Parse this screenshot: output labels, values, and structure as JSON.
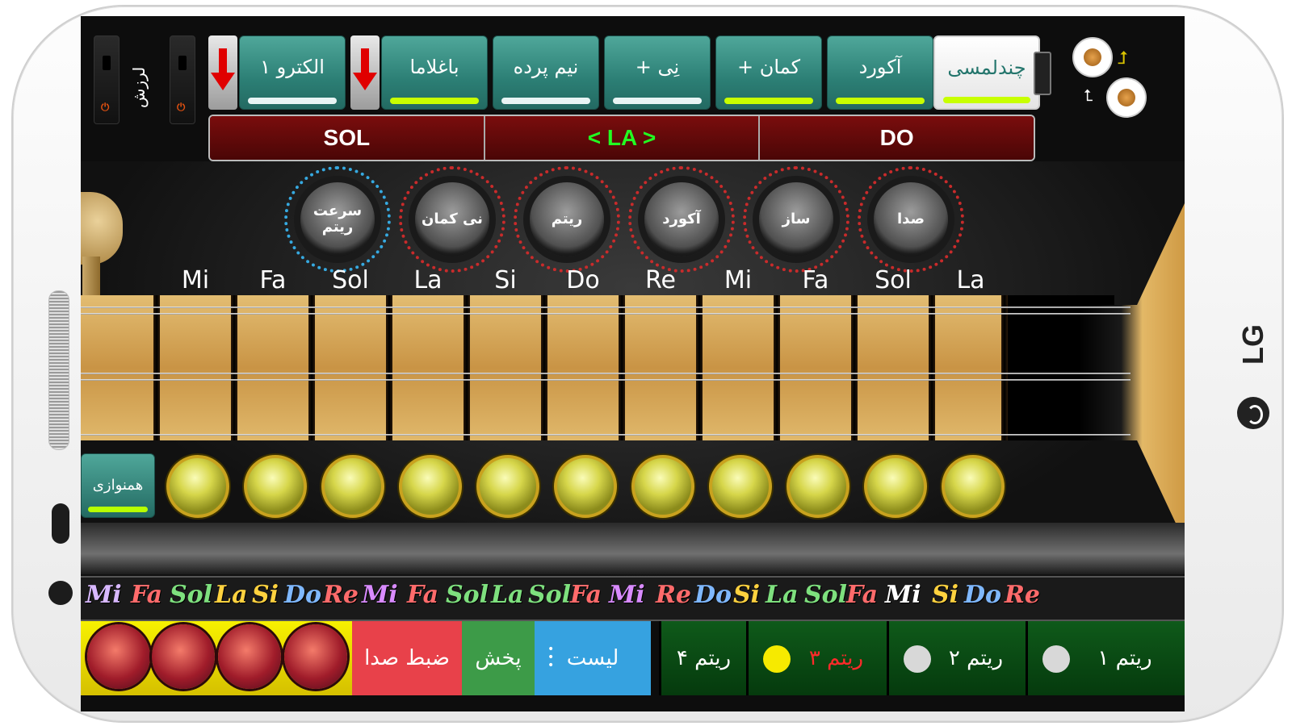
{
  "device": {
    "brand": "LG"
  },
  "top": {
    "vibrato_label": "لرزش",
    "switch_power": "⏻",
    "tabs": [
      {
        "label": "الکترو ۱",
        "bar_color": "#e8f4f4"
      },
      {
        "label": "باغلاما",
        "bar_color": "#c8ff00"
      },
      {
        "label": "نیم پرده",
        "bar_color": "#e8f4f4"
      },
      {
        "label": "+ نِی",
        "bar_color": "#e8f4f4"
      },
      {
        "label": "+ کمان",
        "bar_color": "#c8ff00"
      },
      {
        "label": "آکورد",
        "bar_color": "#c8ff00"
      },
      {
        "label": "چندلمسی",
        "bar_color": "#c8ff00"
      }
    ],
    "swap_up": "⮥",
    "swap_down": "⮤"
  },
  "tuning": {
    "left": "SOL",
    "center": "< LA >",
    "right": "DO"
  },
  "knobs": [
    {
      "label": "سرعت ریتم",
      "ring": "blue"
    },
    {
      "label": "نی کمان",
      "ring": "red"
    },
    {
      "label": "ریتم",
      "ring": "red"
    },
    {
      "label": "آکورد",
      "ring": "red"
    },
    {
      "label": "ساز",
      "ring": "red"
    },
    {
      "label": "صدا",
      "ring": "red"
    }
  ],
  "fret_notes": [
    "Mi",
    "Fa",
    "Sol",
    "La",
    "Si",
    "Do",
    "Re",
    "Mi",
    "Fa",
    "Sol",
    "La"
  ],
  "ensemble": {
    "label": "همنوازی"
  },
  "ticker": [
    {
      "t": "Mi",
      "c": "#d8b8ff"
    },
    {
      "t": "Fa",
      "c": "#ff6b6b"
    },
    {
      "t": "Sol",
      "c": "#7ee07e"
    },
    {
      "t": "La",
      "c": "#ffd23f"
    },
    {
      "t": "Si",
      "c": "#ffd23f"
    },
    {
      "t": "Do",
      "c": "#7fb8ff"
    },
    {
      "t": "Re",
      "c": "#ff6b6b"
    },
    {
      "t": "Mi",
      "c": "#d98bff"
    },
    {
      "t": "Fa",
      "c": "#ff6b6b"
    },
    {
      "t": "Sol",
      "c": "#7ee07e"
    },
    {
      "t": "La",
      "c": "#7ee07e"
    },
    {
      "t": "Sol",
      "c": "#7ee07e"
    },
    {
      "t": "Fa",
      "c": "#ff6b6b"
    },
    {
      "t": "Mi",
      "c": "#d98bff"
    },
    {
      "t": "Re",
      "c": "#ff6b6b"
    },
    {
      "t": "Do",
      "c": "#7fb8ff"
    },
    {
      "t": "Si",
      "c": "#ffd23f"
    },
    {
      "t": "La",
      "c": "#7ee07e"
    },
    {
      "t": "Sol",
      "c": "#7ee07e"
    },
    {
      "t": "Fa",
      "c": "#ff6b6b"
    },
    {
      "t": "Mi",
      "c": "#ffffff"
    },
    {
      "t": "Si",
      "c": "#ffd23f"
    },
    {
      "t": "Do",
      "c": "#7fb8ff"
    },
    {
      "t": "Re",
      "c": "#ff6b6b"
    }
  ],
  "bottom": {
    "record": "ضبط صدا",
    "play": "پخش",
    "list": "لیست",
    "rhythms": [
      {
        "label": "ریتم ۴",
        "state": "none"
      },
      {
        "label": "ریتم ۳",
        "state": "on"
      },
      {
        "label": "ریتم ۲",
        "state": "off"
      },
      {
        "label": "ریتم ۱",
        "state": "off"
      }
    ]
  }
}
